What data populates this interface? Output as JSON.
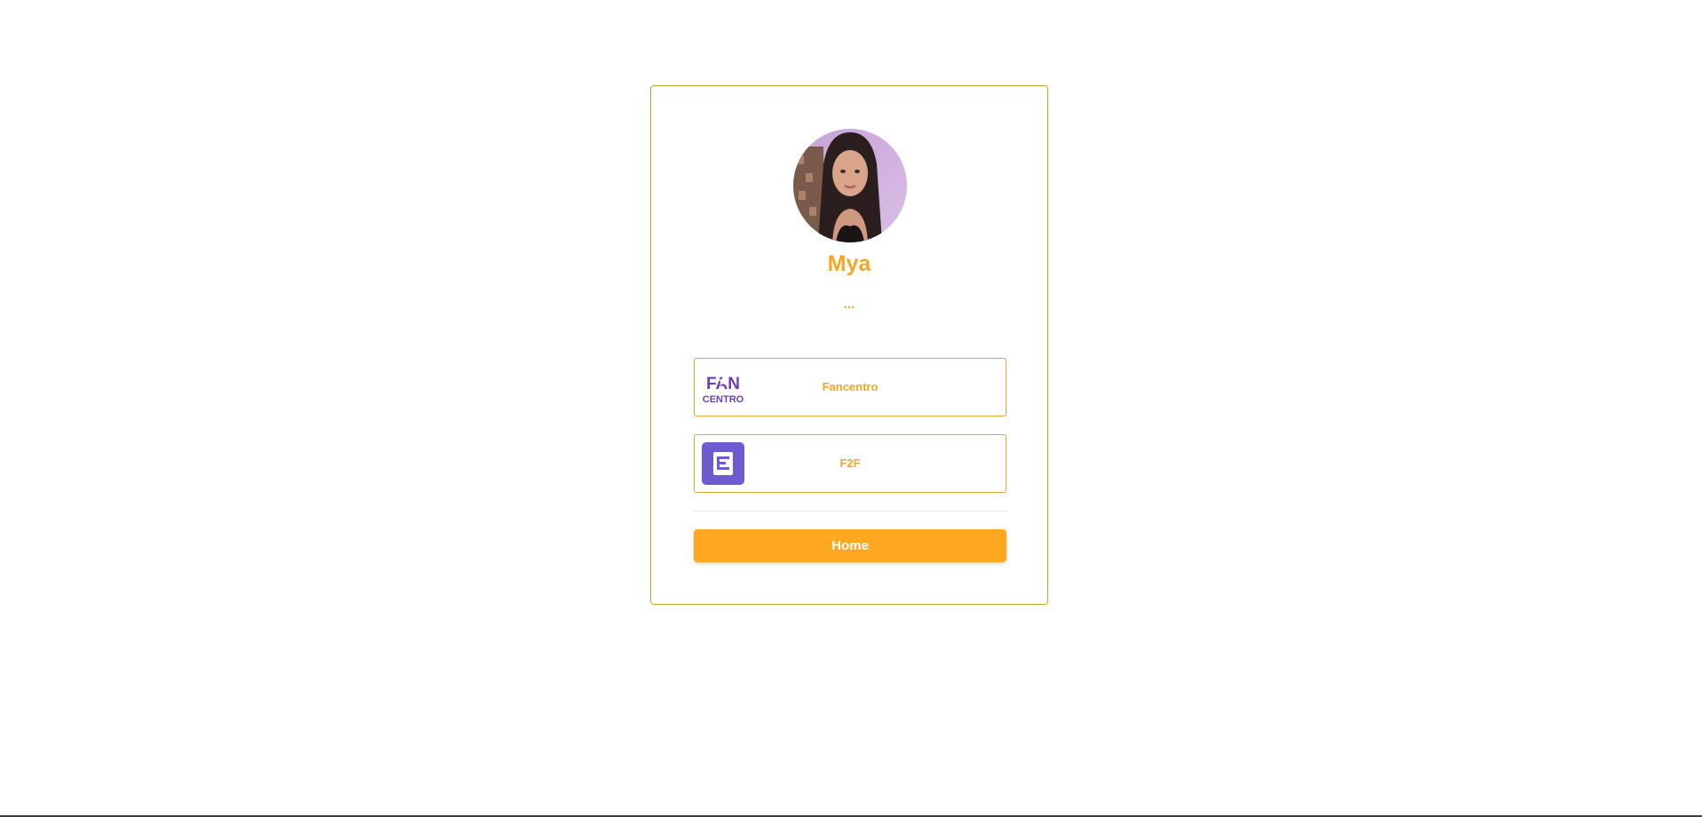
{
  "profile": {
    "name": "Mya",
    "bio": "...",
    "avatar_icon": "profile-photo"
  },
  "links": [
    {
      "label": "Fancentro",
      "icon": "fancentro-logo",
      "logo_text": [
        "FAN",
        "CENTRO"
      ]
    },
    {
      "label": "F2F",
      "icon": "f2f-logo"
    }
  ],
  "home_button": {
    "label": "Home"
  },
  "colors": {
    "accent": "#f5a623",
    "card_border": "#c9a227",
    "home_button": "#ffa81f",
    "logo_purple": "#6b3fb5"
  }
}
